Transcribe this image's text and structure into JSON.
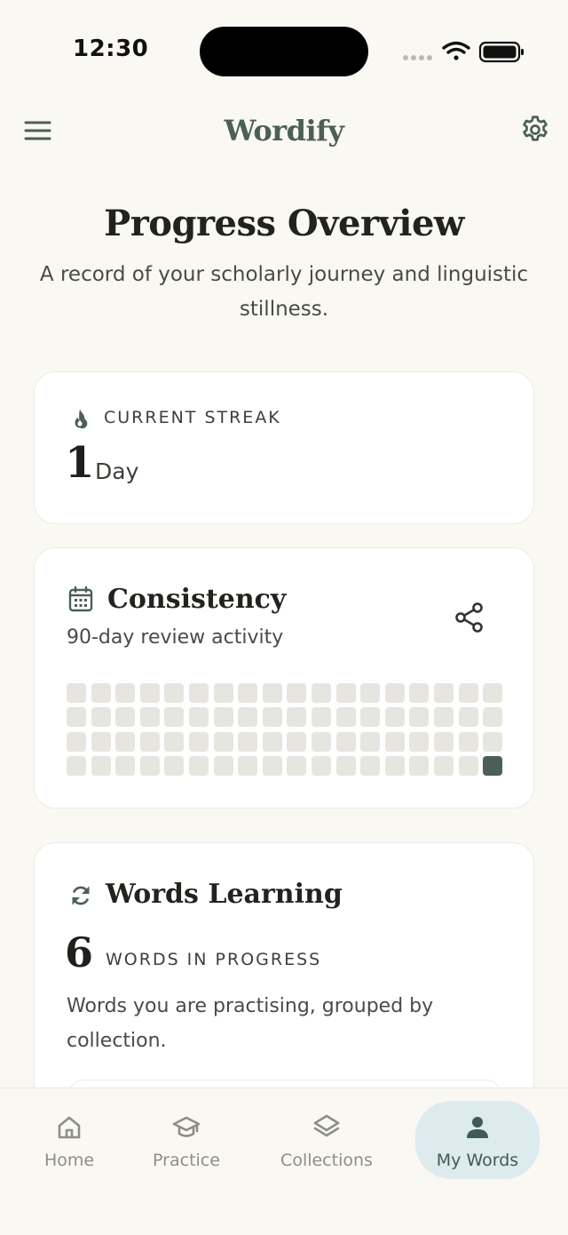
{
  "status_bar": {
    "time": "12:30"
  },
  "app_bar": {
    "title": "Wordify"
  },
  "hero": {
    "title": "Progress Overview",
    "subtitle": "A record of your scholarly journey and linguistic stillness."
  },
  "streak": {
    "label": "CURRENT STREAK",
    "value": "1",
    "unit": "Day",
    "icon": "flame-icon"
  },
  "consistency": {
    "title": "Consistency",
    "subtitle": "90-day review activity",
    "icon": "calendar-icon",
    "share_icon": "share-icon",
    "rows": 4,
    "cols": 18,
    "active_cells": [
      71
    ],
    "colors": {
      "inactive": "#E7E5DF",
      "active": "#4B5F56"
    }
  },
  "learning": {
    "title": "Words Learning",
    "count": "6",
    "count_label": "WORDS IN PROGRESS",
    "description": "Words you are practising, grouped by collection.",
    "icon": "sync-icon"
  },
  "bottom_nav": {
    "items": [
      {
        "label": "Home",
        "icon": "home-icon",
        "active": false
      },
      {
        "label": "Practice",
        "icon": "graduation-cap-icon",
        "active": false
      },
      {
        "label": "Collections",
        "icon": "layers-icon",
        "active": false
      },
      {
        "label": "My Words",
        "icon": "user-icon",
        "active": true
      }
    ]
  },
  "colors": {
    "background": "#FAF8F3",
    "brand": "#4B5F56",
    "card": "#FFFFFF",
    "active_nav": "#DDEBEF"
  }
}
